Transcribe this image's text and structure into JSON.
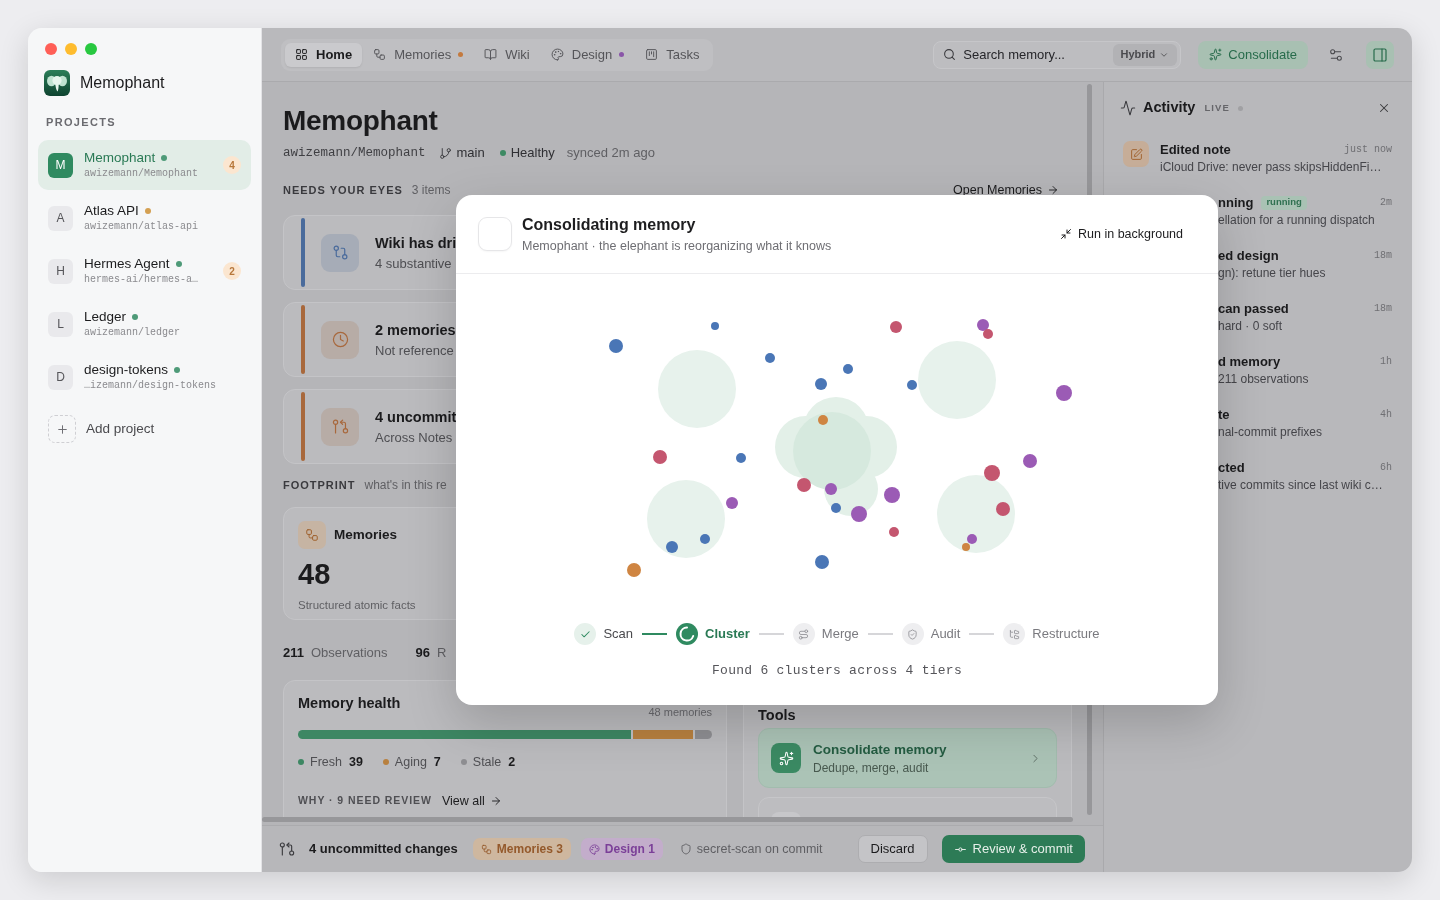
{
  "sidebar": {
    "app_name": "Memophant",
    "section_label": "PROJECTS",
    "projects": [
      {
        "initial": "M",
        "name": "Memophant",
        "color": "#4e9a78",
        "repo": "awizemann/Memophant",
        "badge": "4",
        "selected": true
      },
      {
        "initial": "A",
        "name": "Atlas API",
        "color": "#d4a052",
        "repo": "awizemann/atlas-api",
        "selected": false
      },
      {
        "initial": "H",
        "name": "Hermes Agent",
        "color": "#4e9a78",
        "repo": "hermes-ai/hermes-a…",
        "badge": "2",
        "selected": false
      },
      {
        "initial": "L",
        "name": "Ledger",
        "color": "#4e9a78",
        "repo": "awizemann/ledger",
        "selected": false
      },
      {
        "initial": "D",
        "name": "design-tokens",
        "color": "#4e9a78",
        "repo": "…izemann/design-tokens",
        "selected": false
      }
    ],
    "add_label": "Add project"
  },
  "toolbar": {
    "tabs": [
      {
        "kind": "home",
        "label": "Home",
        "selected": true
      },
      {
        "kind": "memories",
        "label": "Memories",
        "selected": false,
        "color": "#c47a3e"
      },
      {
        "kind": "wiki",
        "label": "Wiki",
        "selected": false
      },
      {
        "kind": "design",
        "label": "Design",
        "selected": false,
        "color": "#8a55a8"
      },
      {
        "kind": "tasks",
        "label": "Tasks",
        "selected": false
      }
    ],
    "search": {
      "placeholder": "Search memory...",
      "mode": "Hybrid"
    },
    "consolidate": "Consolidate",
    "panel_toggle": {
      "on": true
    }
  },
  "header": {
    "title": "Memophant",
    "repo": "awizemann/Memophant",
    "branch": "main",
    "health": "Healthy",
    "synced": "synced 2m ago"
  },
  "needs_your_eyes": {
    "label": "NEEDS YOUR EYES",
    "count": "3 items",
    "link": "Open Memories",
    "items": [
      {
        "kind": "drift",
        "title": "Wiki has dri",
        "subtitle": "4 substantive",
        "color": "#4a6b9c"
      },
      {
        "kind": "stale",
        "title": "2 memories",
        "subtitle": "Not reference",
        "color": "#a8683c"
      },
      {
        "kind": "changes",
        "title": "4 uncommit",
        "subtitle": "Across Notes",
        "color": "#a8683c"
      }
    ]
  },
  "footprint": {
    "label": "FOOTPRINT",
    "hint": "what's in this re",
    "card": {
      "title": "Memories",
      "value": "48",
      "caption": "Structured atomic facts"
    },
    "stats": [
      {
        "value": "211",
        "label": "Observations"
      },
      {
        "value": "96",
        "label": "R"
      }
    ]
  },
  "memory_health": {
    "title": "Memory health",
    "count": "48 memories",
    "segments": [
      {
        "label": "Fresh",
        "value": "39",
        "color": "#3d8763"
      },
      {
        "label": "Aging",
        "value": "7",
        "color": "#b8803f"
      },
      {
        "label": "Stale",
        "value": "2",
        "color": "#8e8e92"
      }
    ],
    "review_label": "WHY · 9 NEED REVIEW",
    "view_all": "View all"
  },
  "tools": {
    "title": "Tools",
    "items": [
      {
        "title": "Consolidate memory",
        "subtitle": "Dedupe, merge, audit",
        "highlighted": true
      },
      {
        "highlighted": false
      }
    ]
  },
  "commit_bar": {
    "summary": "4 uncommitted changes",
    "badges": [
      {
        "kind": "memories",
        "label": "Memories 3",
        "color": "#94592b"
      },
      {
        "kind": "design",
        "label": "Design 1",
        "color": "#7b3f98"
      }
    ],
    "scan_note": "secret-scan on commit",
    "discard": "Discard",
    "commit": "Review & commit"
  },
  "activity": {
    "title": "Activity",
    "live": "LIVE",
    "events": [
      {
        "kind": "edit",
        "title": "Edited note",
        "time": "just now",
        "detail": "iCloud Drive: never pass skipsHiddenFi…",
        "covered": false
      },
      {
        "title": "nning",
        "badge": "running",
        "time": "2m",
        "detail": "ellation for a running dispatch",
        "covered": true
      },
      {
        "title": "ed design",
        "time": "18m",
        "detail": "gn): retune tier hues",
        "covered": true
      },
      {
        "title": "can passed",
        "time": "18m",
        "detail": "hard · 0 soft",
        "covered": true
      },
      {
        "title": "d memory",
        "time": "1h",
        "detail": "211 observations",
        "covered": true
      },
      {
        "title": "te",
        "time": "4h",
        "detail": "nal-commit prefixes",
        "covered": true
      },
      {
        "title": "cted",
        "time": "6h",
        "detail": "tive commits since last wiki c…",
        "covered": true
      }
    ]
  },
  "modal": {
    "title": "Consolidating memory",
    "subtitle": "Memophant · the elephant is reorganizing what it knows",
    "action": "Run in background",
    "steps": [
      {
        "label": "Scan",
        "done": true,
        "current": false
      },
      {
        "label": "Cluster",
        "done": false,
        "current": true
      },
      {
        "kind": "merge",
        "label": "Merge",
        "done": false,
        "current": false
      },
      {
        "kind": "audit",
        "label": "Audit",
        "done": false,
        "current": false
      },
      {
        "kind": "restructure",
        "label": "Restructure",
        "done": false,
        "current": false
      }
    ],
    "status": "Found 6 clusters across 4 tiers"
  }
}
